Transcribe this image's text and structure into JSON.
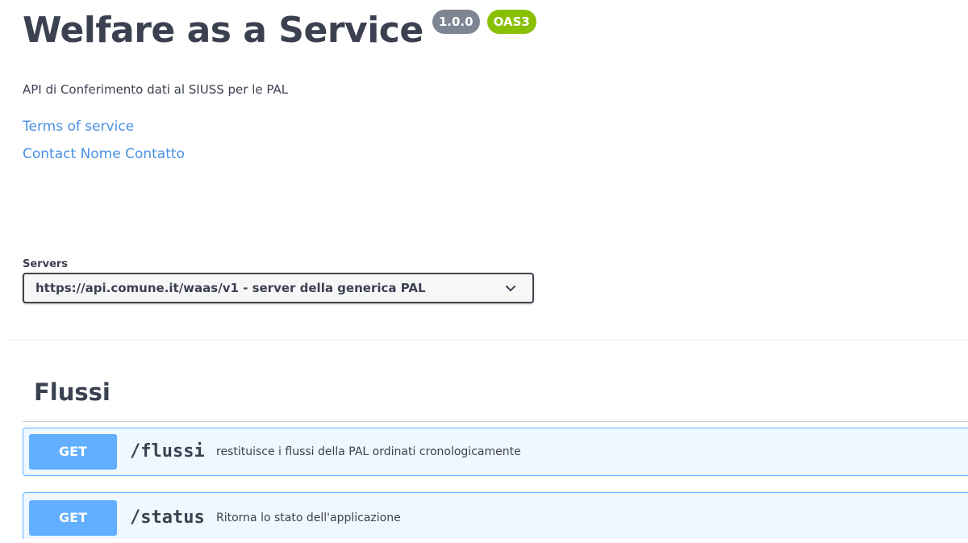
{
  "info": {
    "title": "Welfare as a Service",
    "version_badge": "1.0.0",
    "oas_badge": "OAS3",
    "description": "API di Conferimento dati al SIUSS per le PAL",
    "terms_link": "Terms of service",
    "contact_link": "Contact Nome Contatto"
  },
  "servers": {
    "label": "Servers",
    "selected": "https://api.comune.it/waas/v1 - server della generica PAL"
  },
  "tags": [
    {
      "name": "Flussi",
      "operations": [
        {
          "method": "GET",
          "path": "/flussi",
          "summary": "restituisce i flussi della PAL ordinati cronologicamente"
        },
        {
          "method": "GET",
          "path": "/status",
          "summary": "Ritorna lo stato dell'applicazione"
        }
      ]
    }
  ],
  "colors": {
    "version_badge": "#7d8492",
    "oas_badge": "#89bf04",
    "get_method": "#61affe",
    "link": "#4990e2",
    "text": "#3b4151"
  }
}
